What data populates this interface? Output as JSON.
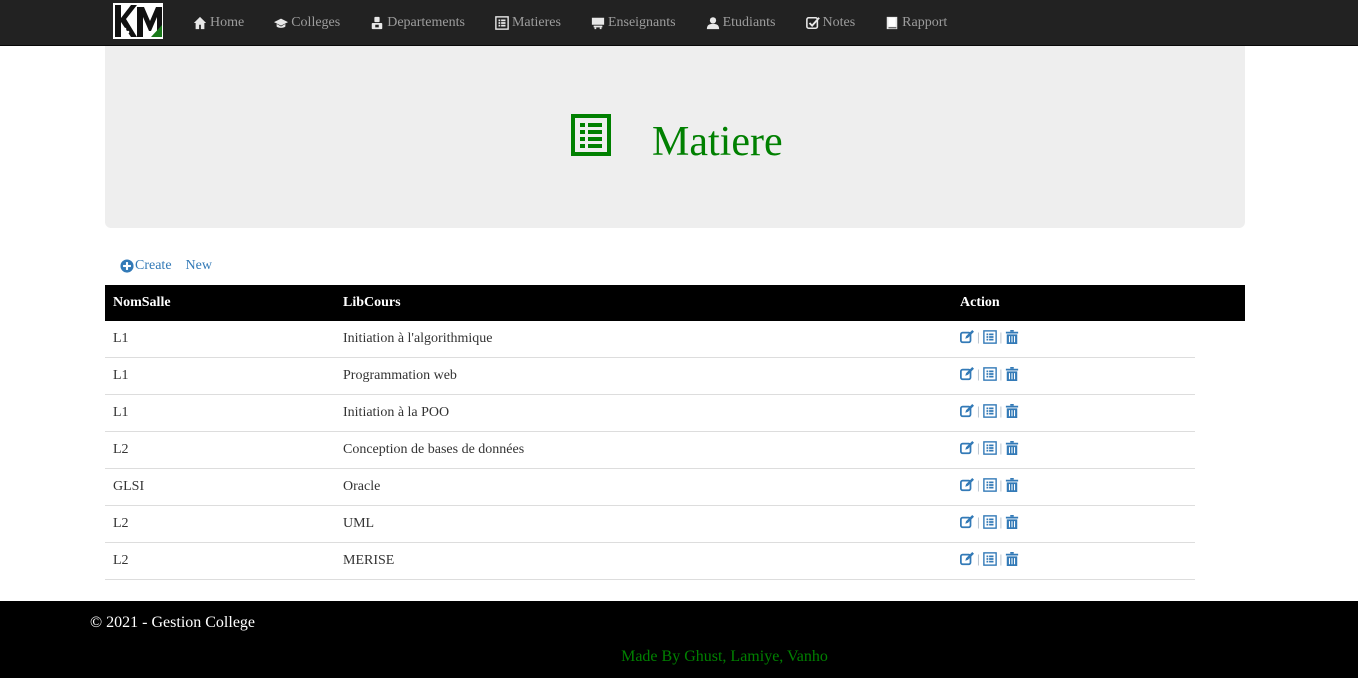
{
  "nav": {
    "items": [
      {
        "label": "Home",
        "icon": "home-icon"
      },
      {
        "label": "Colleges",
        "icon": "graduation-cap-icon"
      },
      {
        "label": "Departements",
        "icon": "user-badge-icon"
      },
      {
        "label": "Matieres",
        "icon": "list-alt-icon"
      },
      {
        "label": "Enseignants",
        "icon": "blackboard-icon"
      },
      {
        "label": "Etudiants",
        "icon": "user-icon"
      },
      {
        "label": "Notes",
        "icon": "check-icon"
      },
      {
        "label": "Rapport",
        "icon": "book-icon"
      }
    ]
  },
  "header": {
    "title": "Matiere",
    "icon": "list-alt-icon"
  },
  "actions": {
    "create_label": "Create",
    "new_label": "New"
  },
  "table": {
    "columns": [
      "NomSalle",
      "LibCours",
      "Action"
    ],
    "rows": [
      {
        "nom_salle": "L1",
        "lib_cours": "Initiation à l'algorithmique"
      },
      {
        "nom_salle": "L1",
        "lib_cours": "Programmation web"
      },
      {
        "nom_salle": "L1",
        "lib_cours": "Initiation à la POO"
      },
      {
        "nom_salle": "L2",
        "lib_cours": "Conception de bases de données"
      },
      {
        "nom_salle": "GLSI",
        "lib_cours": "Oracle"
      },
      {
        "nom_salle": "L2",
        "lib_cours": "UML"
      },
      {
        "nom_salle": "L2",
        "lib_cours": "MERISE"
      }
    ],
    "separator": "|"
  },
  "footer": {
    "copyright": "© 2021 - Gestion College",
    "made_by": "Made By Ghust, Lamiye, Vanho"
  },
  "colors": {
    "accent_green": "#008000",
    "link_blue": "#337ab7",
    "navbar_bg": "#222222",
    "nav_text": "#9d9d9d"
  }
}
